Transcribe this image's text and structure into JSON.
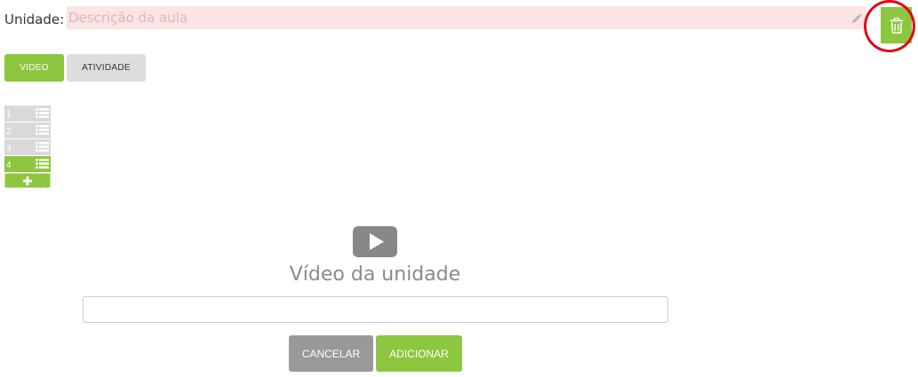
{
  "header": {
    "unit_label": "Unidade:",
    "description_placeholder": "Descrição da aula",
    "description_value": ""
  },
  "tabs": [
    {
      "label": "VIDEO",
      "active": true
    },
    {
      "label": "ATIVIDADE",
      "active": false
    }
  ],
  "units": [
    {
      "number": "1",
      "active": false
    },
    {
      "number": "2",
      "active": false
    },
    {
      "number": "3",
      "active": false
    },
    {
      "number": "4",
      "active": true
    }
  ],
  "video": {
    "title": "Vídeo da unidade",
    "input_value": "",
    "cancel_label": "CANCELAR",
    "add_label": "ADICIONAR"
  },
  "colors": {
    "accent": "#8dc63f",
    "neutral": "#dddddd",
    "error_bg": "#fce4e4",
    "highlight": "#e30613"
  },
  "icons": {
    "edit": "pencil-icon",
    "delete": "trash-icon",
    "list": "list-icon",
    "add": "plus-icon",
    "video": "play-icon"
  }
}
